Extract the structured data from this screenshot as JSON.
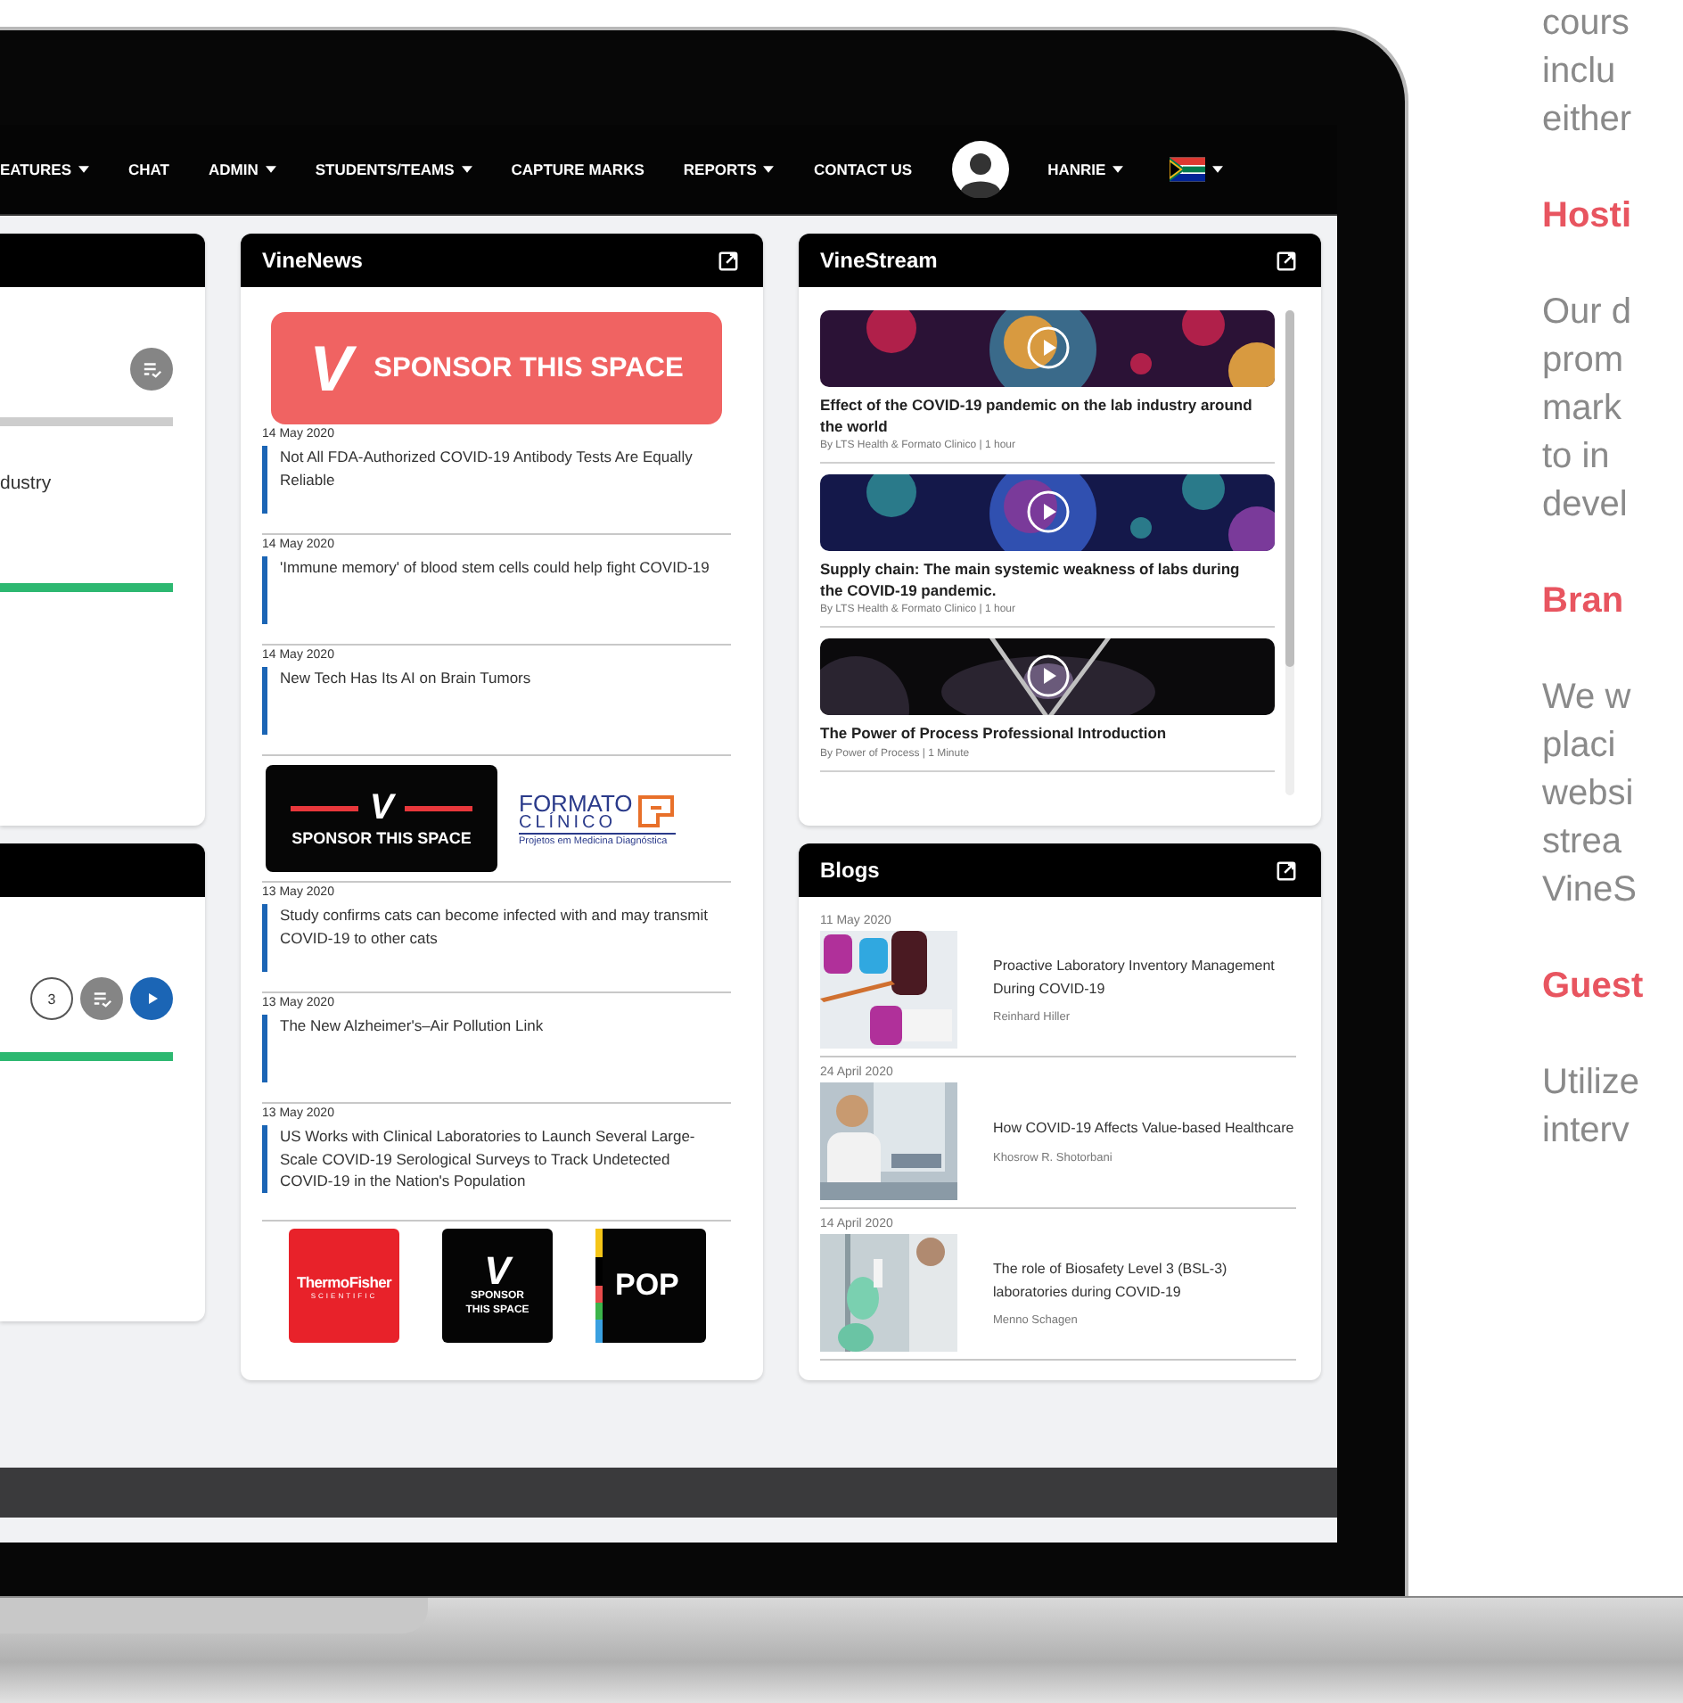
{
  "nav": {
    "items": [
      {
        "label": "EATURES",
        "dropdown": true
      },
      {
        "label": "CHAT",
        "dropdown": false
      },
      {
        "label": "ADMIN",
        "dropdown": true
      },
      {
        "label": "STUDENTS/TEAMS",
        "dropdown": true
      },
      {
        "label": "CAPTURE MARKS",
        "dropdown": false
      },
      {
        "label": "REPORTS",
        "dropdown": true
      },
      {
        "label": "CONTACT US",
        "dropdown": false
      }
    ],
    "user": {
      "name": "HANRIE",
      "dropdown": true
    },
    "language": {
      "dropdown": true
    }
  },
  "left_cards": [
    {
      "items": [
        {
          "kind": "icon_button"
        },
        {
          "kind": "bar",
          "level": 0
        },
        {
          "kind": "text",
          "text": "dustry"
        },
        {
          "kind": "bar",
          "level": 1
        }
      ]
    },
    {
      "items": [
        {
          "kind": "actions",
          "count": "3"
        },
        {
          "kind": "bar",
          "level": 1
        }
      ]
    }
  ],
  "vinenews": {
    "title": "VineNews",
    "blocks": [
      {
        "kind": "banner",
        "logo_letter": "V",
        "text": "SPONSOR THIS SPACE"
      },
      {
        "kind": "news",
        "date": "14 May 2020",
        "title": "Not All FDA-Authorized COVID-19 Antibody Tests Are Equally Reliable"
      },
      {
        "kind": "news",
        "date": "14 May 2020",
        "title": "'Immune memory' of blood stem cells could help fight COVID-19"
      },
      {
        "kind": "news",
        "date": "14 May 2020",
        "title": "New Tech Has Its AI on Brain Tumors"
      },
      {
        "kind": "ads",
        "logo_letter": "V",
        "sponsor": "SPONSOR THIS SPACE",
        "partner": {
          "name": "FORMATO",
          "sub": "CLÍNICO",
          "tagline": "Projetos em Medicina Diagnóstica"
        }
      },
      {
        "kind": "news",
        "date": "13 May 2020",
        "title": "Study confirms cats can become infected with and may transmit COVID-19 to other cats"
      },
      {
        "kind": "news",
        "date": "13 May 2020",
        "title": "The New Alzheimer's–Air Pollution Link"
      },
      {
        "kind": "news",
        "date": "13 May 2020",
        "title": "US Works with Clinical Laboratories to Launch Several Large-Scale COVID-19 Serological Surveys to Track Undetected COVID-19 in the Nation's Population"
      },
      {
        "kind": "logos",
        "logos": [
          {
            "kind": "thermo",
            "name": "ThermoFisher",
            "sub": "SCIENTIFIC"
          },
          {
            "kind": "sponsor",
            "logo_letter": "V",
            "name": "SPONSOR THIS SPACE"
          },
          {
            "kind": "pop",
            "name": "POP"
          }
        ]
      }
    ]
  },
  "vinestream": {
    "title": "VineStream",
    "items": [
      {
        "title": "Effect of the COVID-19 pandemic on the lab industry around the world",
        "meta": "By LTS Health & Formato Clinico | 1 hour"
      },
      {
        "title": "Supply chain: The main systemic weakness of labs during the COVID-19 pandemic.",
        "meta": "By LTS Health & Formato Clinico | 1 hour"
      },
      {
        "title": "The Power of Process Professional Introduction",
        "meta": "By Power of Process | 1 Minute"
      }
    ]
  },
  "blogs": {
    "title": "Blogs",
    "items": [
      {
        "date": "11 May 2020",
        "title": "Proactive Laboratory Inventory Management During COVID-19",
        "author": "Reinhard Hiller"
      },
      {
        "date": "24 April 2020",
        "title": "How COVID-19 Affects Value-based Healthcare",
        "author": "Khosrow R. Shotorbani"
      },
      {
        "date": "14 April 2020",
        "title": "The role of Biosafety Level 3 (BSL-3) laboratories during COVID-19",
        "author": "Menno Schagen"
      }
    ]
  },
  "side_text": [
    {
      "kind": "body",
      "lines": [
        "cours",
        "inclu",
        "either"
      ]
    },
    {
      "kind": "heading",
      "lines": [
        "Hosti"
      ]
    },
    {
      "kind": "body",
      "lines": [
        "Our d",
        "prom",
        "mark",
        "to in",
        "devel"
      ]
    },
    {
      "kind": "heading",
      "lines": [
        "Bran"
      ]
    },
    {
      "kind": "body",
      "lines": [
        "We w",
        "placi",
        "websi",
        "strea",
        "VineS"
      ]
    },
    {
      "kind": "heading",
      "lines": [
        "Guest"
      ]
    },
    {
      "kind": "body",
      "lines": [
        "Utilize",
        "interv"
      ]
    }
  ]
}
